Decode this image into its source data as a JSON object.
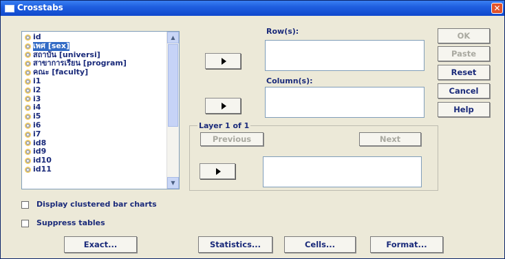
{
  "window": {
    "title": "Crosstabs",
    "close_glyph": "✕"
  },
  "variables": [
    {
      "label": "id"
    },
    {
      "label": "เพศ [sex]",
      "selected": true
    },
    {
      "label": "สถาบัน [universi]"
    },
    {
      "label": "สาขาการเรียน [program]"
    },
    {
      "label": "คณะ [faculty]"
    },
    {
      "label": "i1"
    },
    {
      "label": "i2"
    },
    {
      "label": "i3"
    },
    {
      "label": "i4"
    },
    {
      "label": "i5"
    },
    {
      "label": "i6"
    },
    {
      "label": "i7"
    },
    {
      "label": "id8"
    },
    {
      "label": "id9"
    },
    {
      "label": "id10"
    },
    {
      "label": "id11"
    }
  ],
  "rows_label": "Row(s):",
  "columns_label": "Column(s):",
  "layer": {
    "title": "Layer 1 of 1",
    "previous_label": "Previous",
    "next_label": "Next"
  },
  "buttons": {
    "ok": "OK",
    "paste": "Paste",
    "reset": "Reset",
    "cancel": "Cancel",
    "help": "Help"
  },
  "options": {
    "clustered_bar_charts": {
      "label": "Display clustered bar charts",
      "checked": false
    },
    "suppress_tables": {
      "label": "Suppress tables",
      "checked": false
    }
  },
  "bottom_buttons": {
    "exact": "Exact...",
    "statistics": "Statistics...",
    "cells": "Cells...",
    "format": "Format..."
  },
  "icons": {
    "variable": "scale-variable-icon",
    "arrow": "right-arrow-icon"
  },
  "colors": {
    "titlebar": "#1f5fe0",
    "selection": "#316ac5",
    "label_text": "#1a2a7a",
    "dialog_bg": "#ece9d8"
  }
}
